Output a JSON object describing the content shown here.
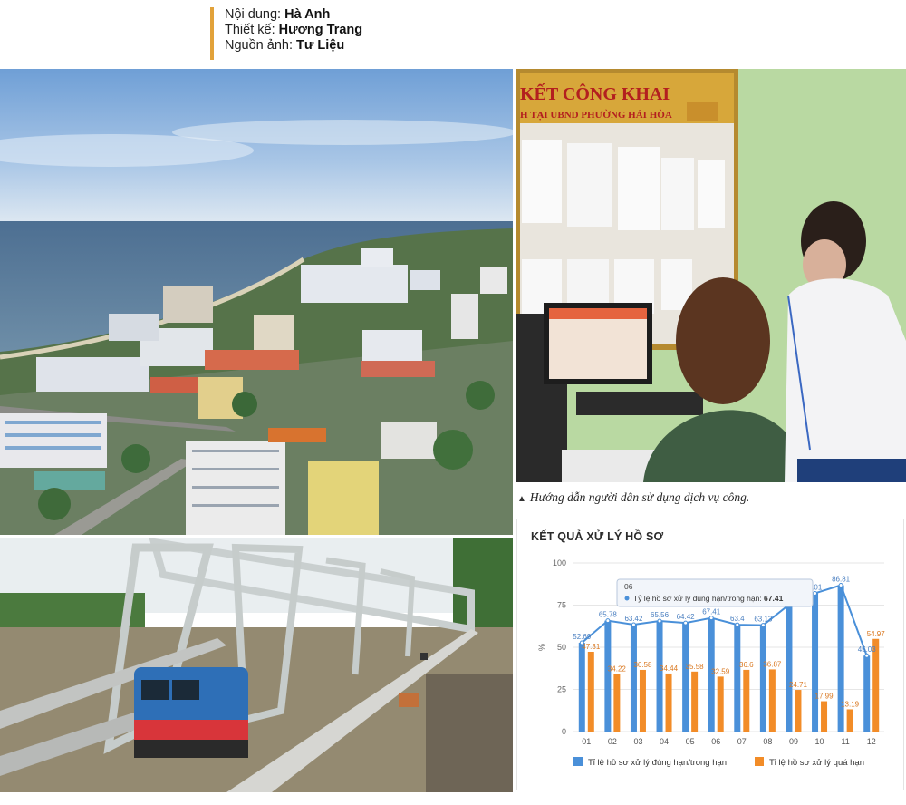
{
  "credits": {
    "content_label": "Nội dung:",
    "content_value": "Hà Anh",
    "design_label": "Thiết kế:",
    "design_value": "Hương Trang",
    "source_label": "Nguồn ảnh:",
    "source_value": "Tư Liệu"
  },
  "office_photo": {
    "sign_line1": "KẾT CÔNG KHAI",
    "sign_line2": "H TẠI UBND PHƯỜNG HẢI HÒA"
  },
  "caption": "Hướng dẫn người dân sử dụng dịch vụ công.",
  "chart_data": {
    "type": "bar",
    "title": "KẾT QUẢ XỬ LÝ HỒ SƠ",
    "ylabel": "%",
    "ylim": [
      0,
      100
    ],
    "yticks": [
      0,
      25,
      50,
      75,
      100
    ],
    "categories": [
      "01",
      "02",
      "03",
      "04",
      "05",
      "06",
      "07",
      "08",
      "09",
      "10",
      "11",
      "12"
    ],
    "series": [
      {
        "name": "Tỉ lệ hồ sơ xử lý đúng hạn/trong hạn",
        "color": "#4a90d9",
        "values": [
          52.69,
          65.78,
          63.42,
          65.56,
          64.42,
          67.41,
          63.4,
          63.13,
          75.29,
          82.01,
          86.81,
          45.03
        ],
        "labels": [
          "52.69",
          "65.78",
          "63.42",
          "65.56",
          "64.42",
          "67.41",
          "63.4",
          "63.13",
          "",
          "2.01",
          "86.81",
          "45.03"
        ]
      },
      {
        "name": "Tỉ lệ hồ sơ xử lý quá hạn",
        "color": "#f28c28",
        "values": [
          47.31,
          34.22,
          36.58,
          34.44,
          35.58,
          32.59,
          36.6,
          36.87,
          24.71,
          17.99,
          13.19,
          54.97
        ],
        "labels": [
          "47.31",
          "34.22",
          "36.58",
          "34.44",
          "35.58",
          "32.59",
          "36.6",
          "36.87",
          "24.71",
          "17.99",
          "13.19",
          "54.97"
        ]
      }
    ],
    "tooltip": {
      "category": "06",
      "series_label": "Tỷ lệ hồ sơ xử lý đúng hạn/trong hạn:",
      "value": "67.41"
    },
    "legend_position": "bottom"
  }
}
